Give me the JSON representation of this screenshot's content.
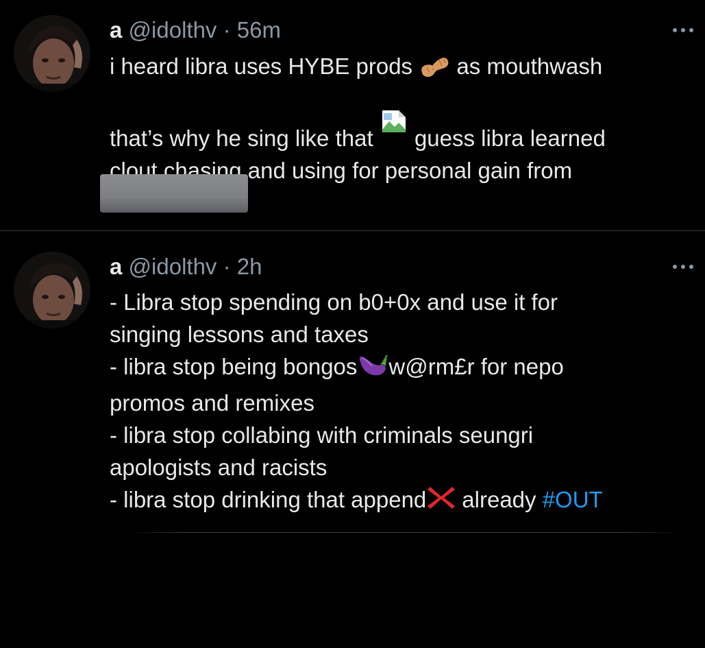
{
  "tweets": [
    {
      "display_name": "a",
      "handle": "@idolthv",
      "separator": "·",
      "time": "56m",
      "avatar_icon": "profile-photo",
      "lines": [
        "i heard libra uses HYBE prods",
        "as mouthwash",
        "that’s why he sing like that",
        "guess libra learned",
        "clout chasing and using for personal gain from"
      ],
      "emojis": [
        "peanut-emoji",
        "broken-image-icon"
      ],
      "redacted": true
    },
    {
      "display_name": "a",
      "handle": "@idolthv",
      "separator": "·",
      "time": "2h",
      "avatar_icon": "profile-photo",
      "lines": [
        "- Libra stop spending on b0+0x and use it for",
        "singing lessons and taxes",
        "- libra stop being bongos",
        "w@rm£r for nepo",
        "promos and remixes",
        "- libra stop collabing with criminals seungri",
        "apologists and racists",
        "- libra stop drinking that append",
        "already",
        "#OUT"
      ],
      "emojis": [
        "eggplant-emoji",
        "red-x-emoji"
      ]
    }
  ],
  "colors": {
    "background": "#000000",
    "text": "#e7e9ea",
    "muted": "#8b98a5",
    "link": "#1d9bf0",
    "divider": "#3a3d40"
  }
}
